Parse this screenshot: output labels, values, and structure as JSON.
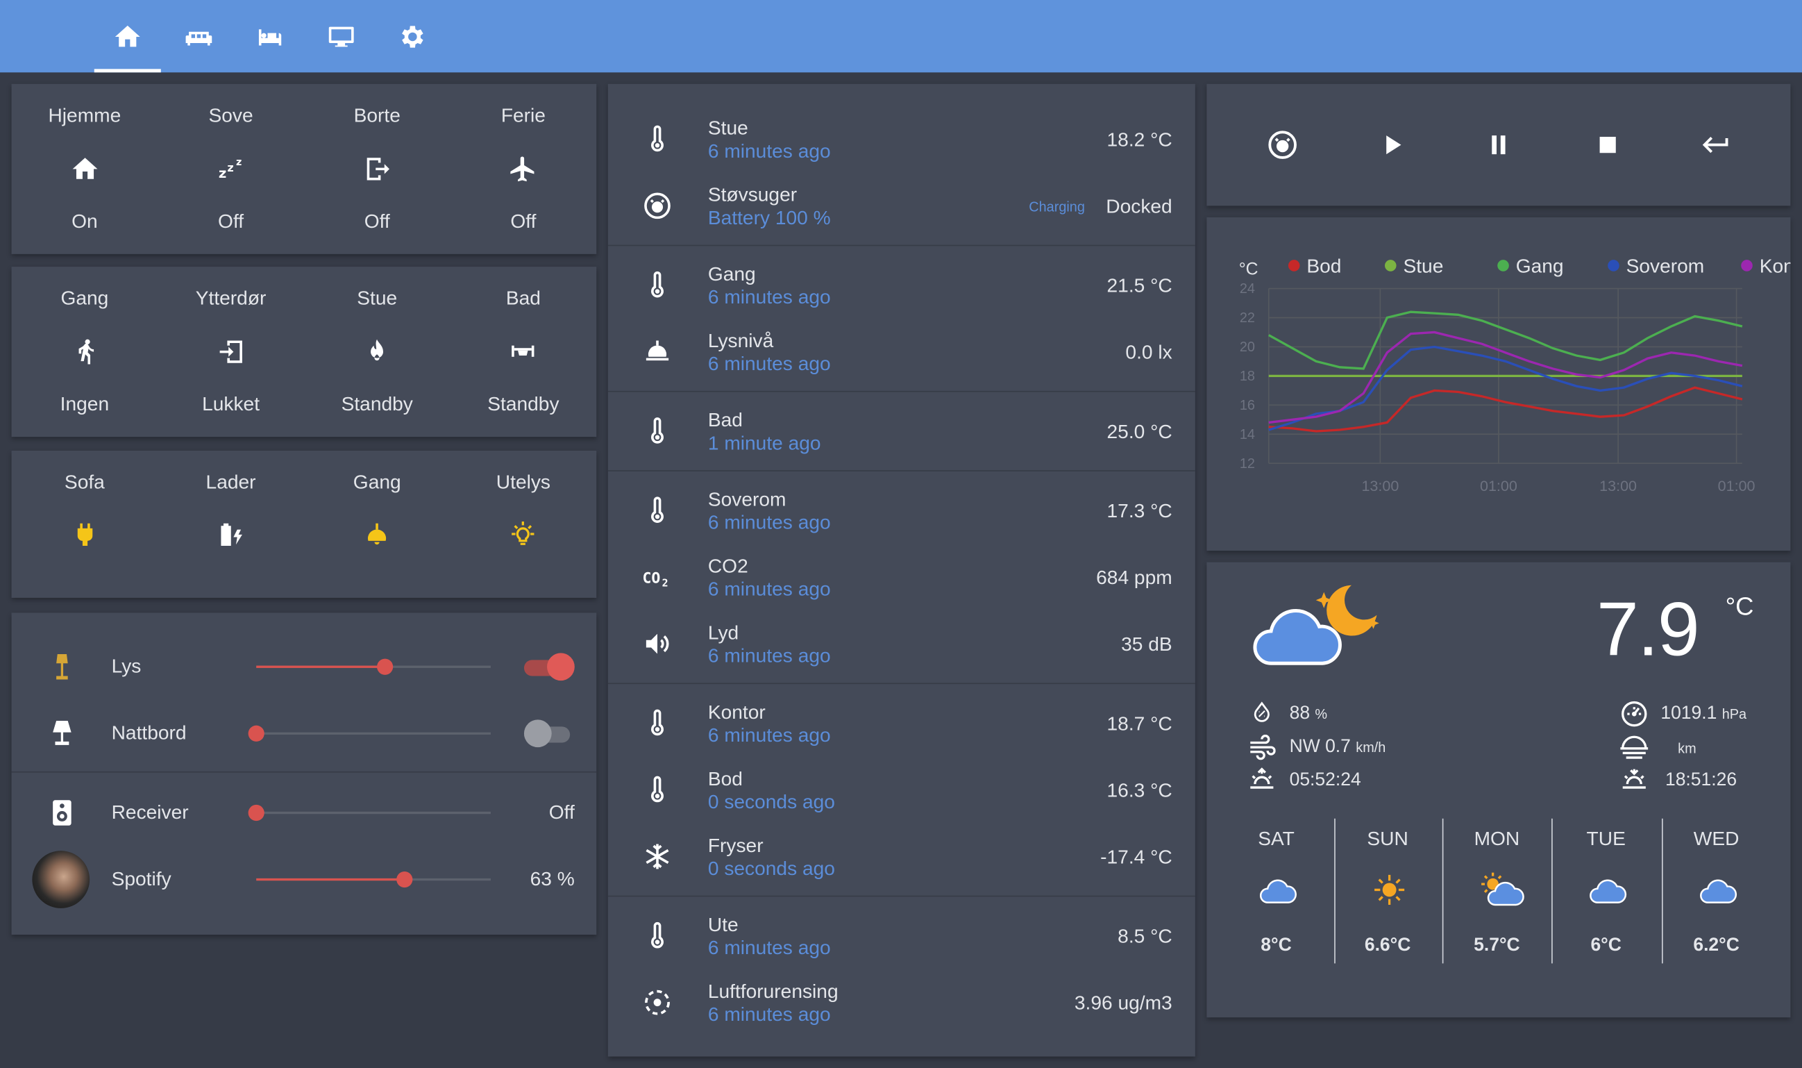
{
  "tabs": [
    {
      "icon": "home-icon"
    },
    {
      "icon": "sofa-icon"
    },
    {
      "icon": "bed-icon"
    },
    {
      "icon": "monitor-icon"
    },
    {
      "icon": "gear-icon"
    }
  ],
  "modes": [
    {
      "label": "Hjemme",
      "icon": "home-icon",
      "state": "On"
    },
    {
      "label": "Sove",
      "icon": "sleep-icon",
      "state": "Off"
    },
    {
      "label": "Borte",
      "icon": "exit-icon",
      "state": "Off"
    },
    {
      "label": "Ferie",
      "icon": "airplane-icon",
      "state": "Off"
    }
  ],
  "sensors": [
    {
      "label": "Gang",
      "icon": "walk-icon",
      "state": "Ingen"
    },
    {
      "label": "Ytterdør",
      "icon": "door-enter-icon",
      "state": "Lukket"
    },
    {
      "label": "Stue",
      "icon": "fire-icon",
      "state": "Standby"
    },
    {
      "label": "Bad",
      "icon": "towel-rail-icon",
      "state": "Standby"
    }
  ],
  "lights": [
    {
      "label": "Sofa",
      "icon": "plug-icon"
    },
    {
      "label": "Lader",
      "icon": "battery-charging-icon"
    },
    {
      "label": "Gang",
      "icon": "ceiling-light-icon"
    },
    {
      "label": "Utelys",
      "icon": "bulb-icon"
    }
  ],
  "controls": {
    "lys": {
      "label": "Lys",
      "level": 0.55,
      "toggle_on": true
    },
    "nattbord": {
      "label": "Nattbord",
      "level": 0.0,
      "toggle_on": false
    },
    "receiver": {
      "label": "Receiver",
      "level": 0.0,
      "state": "Off"
    },
    "spotify": {
      "label": "Spotify",
      "level": 0.63,
      "state": "63 %"
    }
  },
  "entities": [
    {
      "name": "Stue",
      "sub": "6 minutes ago",
      "value": "18.2 °C",
      "icon": "thermometer-icon"
    },
    {
      "name": "Støvsuger",
      "sub": "Battery 100 %",
      "status": "Charging",
      "value": "Docked",
      "icon": "robot-vacuum-icon"
    },
    {
      "name": "Gang",
      "sub": "6 minutes ago",
      "value": "21.5 °C",
      "icon": "thermometer-icon"
    },
    {
      "name": "Lysnivå",
      "sub": "6 minutes ago",
      "value": "0.0 lx",
      "icon": "light-sensor-icon"
    },
    {
      "name": "Bad",
      "sub": "1 minute ago",
      "value": "25.0 °C",
      "icon": "thermometer-icon"
    },
    {
      "name": "Soverom",
      "sub": "6 minutes ago",
      "value": "17.3 °C",
      "icon": "thermometer-icon"
    },
    {
      "name": "CO2",
      "sub": "6 minutes ago",
      "value": "684 ppm",
      "icon": "co2-icon"
    },
    {
      "name": "Lyd",
      "sub": "6 minutes ago",
      "value": "35 dB",
      "icon": "speaker-icon"
    },
    {
      "name": "Kontor",
      "sub": "6 minutes ago",
      "value": "18.7 °C",
      "icon": "thermometer-icon"
    },
    {
      "name": "Bod",
      "sub": "0 seconds ago",
      "value": "16.3 °C",
      "icon": "thermometer-icon"
    },
    {
      "name": "Fryser",
      "sub": "0 seconds ago",
      "value": "-17.4 °C",
      "icon": "snowflake-icon"
    },
    {
      "name": "Ute",
      "sub": "6 minutes ago",
      "value": "8.5 °C",
      "icon": "thermometer-icon"
    },
    {
      "name": "Luftforurensing",
      "sub": "6 minutes ago",
      "value": "3.96 ug/m3",
      "icon": "air-quality-icon"
    }
  ],
  "media_buttons": [
    {
      "icon": "robot-vacuum-icon"
    },
    {
      "icon": "play-icon"
    },
    {
      "icon": "pause-icon"
    },
    {
      "icon": "stop-icon"
    },
    {
      "icon": "return-icon"
    }
  ],
  "chart_data": {
    "type": "line",
    "ylabel": "°C",
    "ylim": [
      12,
      24
    ],
    "yticks": [
      "24",
      "22",
      "20",
      "18",
      "16",
      "14",
      "12"
    ],
    "xticks": [
      "13:00",
      "01:00",
      "13:00",
      "01:00"
    ],
    "grid": true,
    "legend_position": "top",
    "x": [
      0,
      2,
      4,
      6,
      8,
      10,
      12,
      14,
      16,
      18,
      20,
      22,
      24,
      26,
      28,
      30,
      32,
      34,
      36,
      38,
      40
    ],
    "series": [
      {
        "name": "Bod",
        "color": "#c62828",
        "values": [
          14.5,
          14.4,
          14.2,
          14.3,
          14.5,
          14.8,
          16.5,
          17.0,
          16.9,
          16.6,
          16.2,
          15.9,
          15.6,
          15.4,
          15.2,
          15.3,
          15.9,
          16.6,
          17.2,
          16.8,
          16.4
        ]
      },
      {
        "name": "Stue",
        "color": "#7cb342",
        "values": [
          18.0,
          18.0,
          18.0,
          18.0,
          18.0,
          18.0,
          18.0,
          18.0,
          18.0,
          18.0,
          18.0,
          18.0,
          18.0,
          18.0,
          18.0,
          18.0,
          18.0,
          18.0,
          18.0,
          18.0,
          18.0
        ]
      },
      {
        "name": "Gang",
        "color": "#4caf50",
        "values": [
          20.8,
          19.9,
          19.0,
          18.6,
          18.5,
          22.0,
          22.4,
          22.3,
          22.2,
          21.8,
          21.2,
          20.6,
          19.9,
          19.4,
          19.1,
          19.6,
          20.6,
          21.4,
          22.1,
          21.8,
          21.4
        ]
      },
      {
        "name": "Soverom",
        "color": "#2a4fb8",
        "values": [
          14.3,
          14.8,
          15.4,
          15.6,
          16.2,
          18.4,
          19.8,
          20.0,
          19.7,
          19.4,
          19.0,
          18.4,
          17.8,
          17.3,
          17.0,
          17.2,
          17.8,
          18.2,
          18.0,
          17.7,
          17.3
        ]
      },
      {
        "name": "Kontor",
        "color": "#9c27b0",
        "values": [
          14.8,
          15.0,
          15.2,
          15.6,
          16.8,
          19.6,
          20.9,
          21.0,
          20.6,
          20.2,
          19.6,
          19.0,
          18.5,
          18.1,
          17.9,
          18.4,
          19.2,
          19.6,
          19.4,
          19.0,
          18.7
        ]
      }
    ]
  },
  "weather": {
    "icon": "cloudy-night-icon",
    "temperature": "7.9",
    "unit": "°C",
    "humidity": "88",
    "humidity_unit": "%",
    "wind": "NW 0.7",
    "wind_unit": "km/h",
    "sunrise": "05:52:24",
    "pressure": "1019.1",
    "pressure_unit": "hPa",
    "visibility_unit": "km",
    "sunset": "18:51:26",
    "forecast": [
      {
        "day": "SAT",
        "temp": "8°C",
        "icon": "cloud-icon"
      },
      {
        "day": "SUN",
        "temp": "6.6°C",
        "icon": "sun-icon"
      },
      {
        "day": "MON",
        "temp": "5.7°C",
        "icon": "partly-cloudy-icon"
      },
      {
        "day": "TUE",
        "temp": "6°C",
        "icon": "cloud-icon"
      },
      {
        "day": "WED",
        "temp": "6.2°C",
        "icon": "cloud-icon"
      }
    ]
  },
  "colors": {
    "header": "#5f93dc",
    "card": "#444a58",
    "background": "#363b47",
    "accent": "#5b8dd9",
    "slider": "#d9534f",
    "light_on": "#f5c518"
  }
}
